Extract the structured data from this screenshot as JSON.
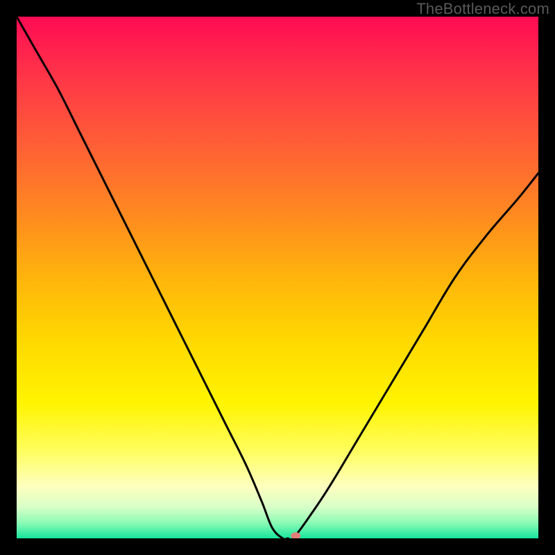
{
  "watermark": "TheBottleneck.com",
  "chart_data": {
    "type": "line",
    "title": "",
    "xlabel": "",
    "ylabel": "",
    "xlim": [
      0,
      100
    ],
    "ylim": [
      0,
      100
    ],
    "background": {
      "type": "vertical-gradient",
      "stops": [
        {
          "pos": 0.0,
          "color": "#ff0b54"
        },
        {
          "pos": 0.12,
          "color": "#ff3747"
        },
        {
          "pos": 0.25,
          "color": "#ff6035"
        },
        {
          "pos": 0.38,
          "color": "#ff8a20"
        },
        {
          "pos": 0.5,
          "color": "#ffb40c"
        },
        {
          "pos": 0.62,
          "color": "#ffd800"
        },
        {
          "pos": 0.74,
          "color": "#fff400"
        },
        {
          "pos": 0.83,
          "color": "#fffd5c"
        },
        {
          "pos": 0.9,
          "color": "#feffbe"
        },
        {
          "pos": 0.94,
          "color": "#d8ffc8"
        },
        {
          "pos": 0.97,
          "color": "#8cfbb5"
        },
        {
          "pos": 1.0,
          "color": "#16e69c"
        }
      ]
    },
    "series": [
      {
        "name": "bottleneck-curve",
        "color": "#000000",
        "x": [
          0,
          4,
          8,
          12,
          16,
          20,
          24,
          28,
          32,
          36,
          40,
          44,
          47,
          49,
          51,
          52,
          53,
          56,
          60,
          66,
          72,
          78,
          84,
          90,
          96,
          100
        ],
        "y": [
          100,
          93,
          86,
          78,
          70,
          62,
          54,
          46,
          38,
          30,
          22,
          14,
          7,
          2,
          0,
          0,
          0,
          4,
          10,
          20,
          30,
          40,
          50,
          58,
          65,
          70
        ]
      }
    ],
    "marker": {
      "name": "optimal-point",
      "x": 53.5,
      "y": 0.5,
      "color": "#e28079",
      "rx": 7,
      "ry": 5
    }
  }
}
